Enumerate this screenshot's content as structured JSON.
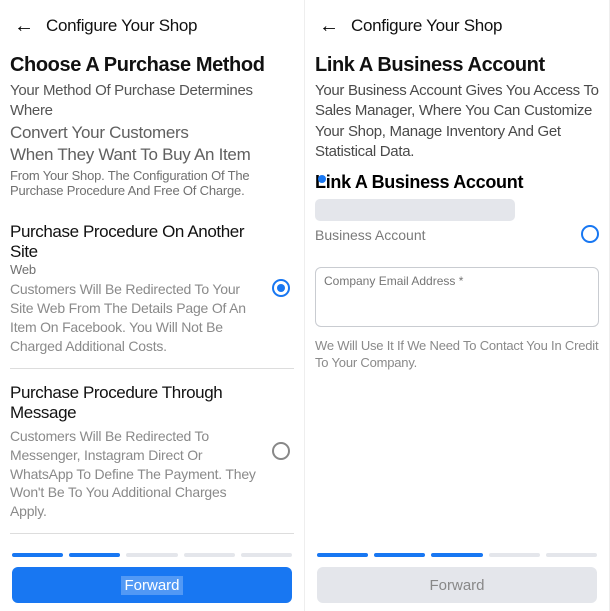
{
  "left": {
    "header_title": "Configure Your Shop",
    "title": "Choose A Purchase Method",
    "lead1": "Your Method Of Purchase Determines Where",
    "lead2": "Convert Your Customers",
    "lead3": "When They Want To Buy An Item",
    "lead4": "From Your Shop. The Configuration Of The Purchase Procedure And Free Of Charge.",
    "opt1_title": "Purchase Procedure On Another Site",
    "opt1_sub_small": "Web",
    "opt1_body": "Customers Will Be Redirected To Your Site Web From The Details Page Of An Item On Facebook. You Will Not Be Charged Additional Costs.",
    "opt2_title": "Purchase Procedure Through Message",
    "opt2_body": "Customers Will Be Redirected To Messenger, Instagram Direct Or WhatsApp To Define The Payment. They Won't Be To You Additional Charges Apply.",
    "forward": "Forward"
  },
  "right": {
    "header_title": "Configure Your Shop",
    "title": "Link A Business Account",
    "lead": "Your Business Account Gives You Access To Sales Manager, Where You Can Customize Your Shop, Manage Inventory And Get Statistical Data.",
    "subtitle": "Link A Business Account",
    "field_label": "Business Account",
    "textarea_placeholder": "Company Email Address *",
    "helper": "We Will Use It If We Need To Contact You In Credit To Your Company.",
    "forward": "Forward"
  },
  "progress": {
    "left_on": 2,
    "right_on": 3,
    "total": 5
  }
}
